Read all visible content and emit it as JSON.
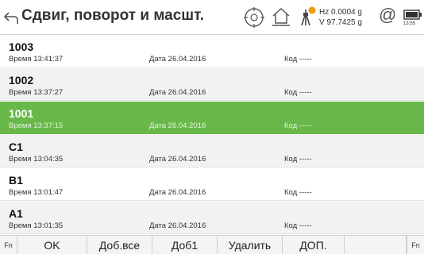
{
  "header": {
    "title": "Сдвиг, поворот и масшт.",
    "hz": "Hz 0.0004 g",
    "v": "V  97.7425 g",
    "at_symbol": "@",
    "battery_time": "13:55",
    "icons": [
      "back-icon",
      "gps-icon",
      "home-icon",
      "prism-icon",
      "battery-icon"
    ]
  },
  "colors": {
    "selected_row": "#69b94a",
    "alt_row": "#f2f2f2"
  },
  "points": [
    {
      "id": "1003",
      "time": "Время  13:41:37",
      "date": "Дата  26.04.2016",
      "code": "Код  -----"
    },
    {
      "id": "1002",
      "time": "Время  13:37:27",
      "date": "Дата  26.04.2016",
      "code": "Код  -----"
    },
    {
      "id": "1001",
      "time": "Время  13:37:15",
      "date": "Дата  26.04.2016",
      "code": "Код  -----"
    },
    {
      "id": "C1",
      "time": "Время  13:04:35",
      "date": "Дата  26.04.2016",
      "code": "Код  -----"
    },
    {
      "id": "B1",
      "time": "Время  13:01:47",
      "date": "Дата  26.04.2016",
      "code": "Код  -----"
    },
    {
      "id": "A1",
      "time": "Время  13:01:35",
      "date": "Дата  26.04.2016",
      "code": "Код  -----"
    }
  ],
  "selected_index": 2,
  "function_keys": {
    "fn_left": "Fn",
    "ok": "OK",
    "add_all": "Доб.все",
    "add_one": "Доб1",
    "delete": "Удалить",
    "more": "ДОП.",
    "empty": "",
    "fn_right": "Fn"
  }
}
